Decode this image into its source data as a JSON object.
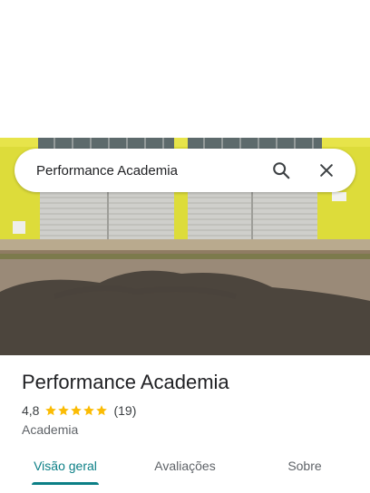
{
  "search": {
    "query": "Performance Academia"
  },
  "place": {
    "title": "Performance Academia",
    "rating": "4,8",
    "stars": 4.8,
    "review_count": "(19)",
    "category": "Academia"
  },
  "tabs": [
    {
      "label": "Visão geral",
      "active": true
    },
    {
      "label": "Avaliações",
      "active": false
    },
    {
      "label": "Sobre",
      "active": false
    }
  ],
  "colors": {
    "accent": "#0b7f86",
    "star": "#fbbc04"
  },
  "icons": [
    "search-icon",
    "close-icon",
    "star-icon"
  ]
}
